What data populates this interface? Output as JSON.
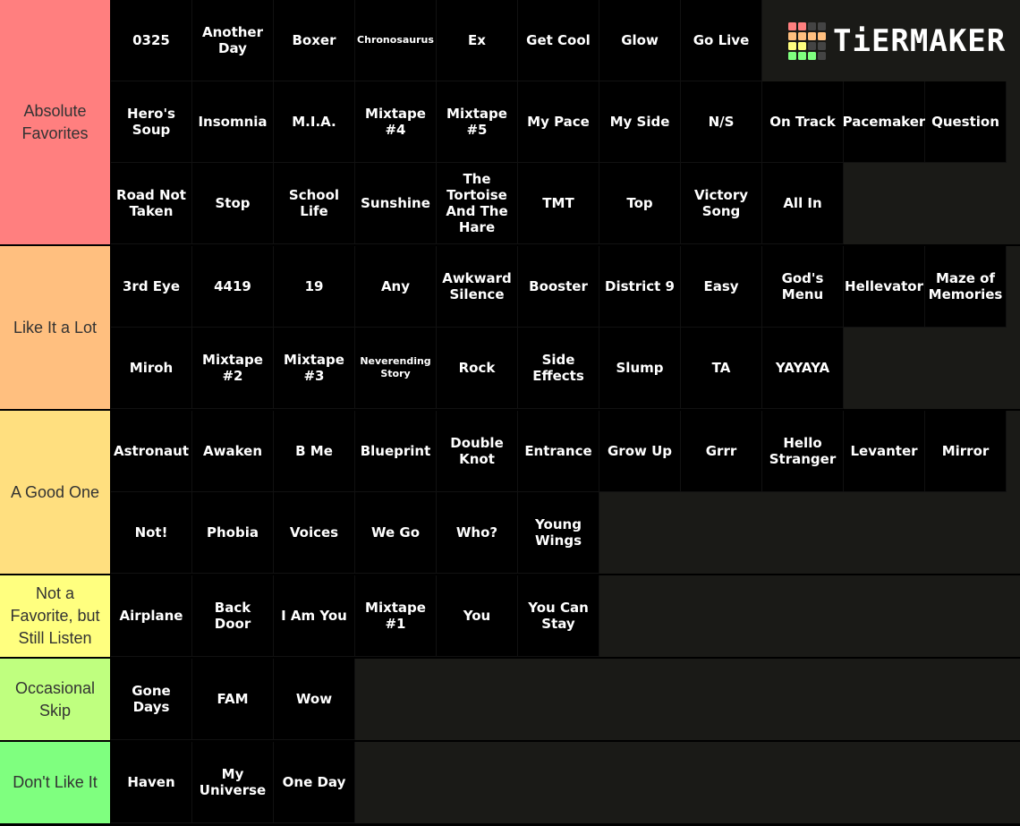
{
  "logo": {
    "text": "TiERMAKER",
    "grid_colors": [
      "#ff7f7f",
      "#ff7f7f",
      "#444",
      "#444",
      "#ffbf7f",
      "#ffbf7f",
      "#ffbf7f",
      "#ffbf7f",
      "#ffff7f",
      "#ffff7f",
      "#444",
      "#444",
      "#7fff7f",
      "#7fff7f",
      "#7fff7f",
      "#444"
    ]
  },
  "tiers": [
    {
      "label": "Absolute Favorites",
      "color": "#ff7f7f",
      "rows": 3,
      "items": [
        "0325",
        "Another Day",
        "Boxer",
        "Chronosaurus",
        "Ex",
        "Get Cool",
        "Glow",
        "Go Live",
        "Hero's Soup",
        "Insomnia",
        "M.I.A.",
        "Mixtape #4",
        "Mixtape #5",
        "My Pace",
        "My Side",
        "N/S",
        "On Track",
        "Pacemaker",
        "Question",
        "Road Not Taken",
        "Stop",
        "School Life",
        "Sunshine",
        "The Tortoise And The Hare",
        "TMT",
        "Top",
        "Victory Song",
        "All In"
      ]
    },
    {
      "label": "Like It a Lot",
      "color": "#ffbf7f",
      "rows": 2,
      "items": [
        "3rd Eye",
        "4419",
        "19",
        "Any",
        "Awkward Silence",
        "Booster",
        "District 9",
        "Easy",
        "God's Menu",
        "Hellevator",
        "Maze of Memories",
        "Miroh",
        "Mixtape #2",
        "Mixtape #3",
        "Neverending Story",
        "Rock",
        "Side Effects",
        "Slump",
        "TA",
        "YAYAYA"
      ]
    },
    {
      "label": "A Good One",
      "color": "#ffdf7f",
      "rows": 2,
      "items": [
        "Astronaut",
        "Awaken",
        "B Me",
        "Blueprint",
        "Double Knot",
        "Entrance",
        "Grow Up",
        "Grrr",
        "Hello Stranger",
        "Levanter",
        "Mirror",
        "Not!",
        "Phobia",
        "Voices",
        "We Go",
        "Who?",
        "Young Wings"
      ]
    },
    {
      "label": "Not a Favorite, but Still Listen",
      "color": "#ffff7f",
      "rows": 1,
      "items": [
        "Airplane",
        "Back Door",
        "I Am You",
        "Mixtape #1",
        "You",
        "You Can Stay"
      ]
    },
    {
      "label": "Occasional Skip",
      "color": "#bfff7f",
      "rows": 1,
      "items": [
        "Gone Days",
        "FAM",
        "Wow"
      ]
    },
    {
      "label": "Don't Like It",
      "color": "#7fff7f",
      "rows": 1,
      "items": [
        "Haven",
        "My Universe",
        "One Day"
      ]
    }
  ]
}
